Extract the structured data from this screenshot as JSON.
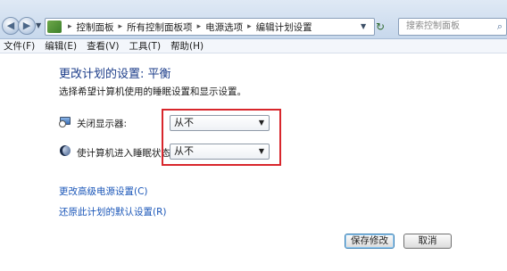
{
  "address_bar": {
    "breadcrumbs": [
      "控制面板",
      "所有控制面板项",
      "电源选项",
      "编辑计划设置"
    ],
    "separator": "▸",
    "search_placeholder": "搜索控制面板"
  },
  "menu": {
    "items": [
      "文件(F)",
      "编辑(E)",
      "查看(V)",
      "工具(T)",
      "帮助(H)"
    ]
  },
  "main": {
    "heading": "更改计划的设置: 平衡",
    "subtext": "选择希望计算机使用的睡眠设置和显示设置。",
    "settings": [
      {
        "label": "关闭显示器:",
        "value": "从不",
        "icon": "monitor-clock-icon"
      },
      {
        "label": "使计算机进入睡眠状态:",
        "value": "从不",
        "icon": "moon-icon"
      }
    ],
    "links": [
      "更改高级电源设置(C)",
      "还原此计划的默认设置(R)"
    ],
    "buttons": {
      "save": "保存修改",
      "cancel": "取消"
    }
  },
  "colors": {
    "heading": "#1c3d8a",
    "link": "#1a56b8",
    "highlight": "#d8262c"
  }
}
